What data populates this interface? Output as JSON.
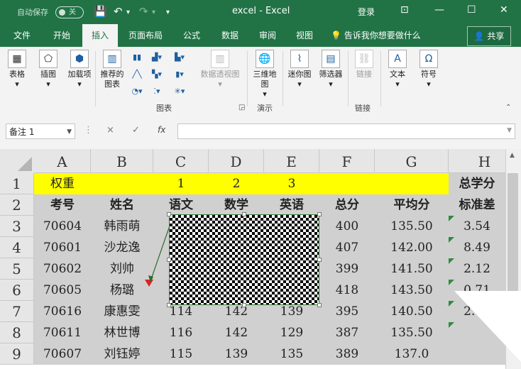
{
  "titlebar": {
    "autosave_label": "自动保存",
    "autosave_state": "关",
    "title": "excel  -  Excel",
    "login": "登录",
    "save_icon": "save-icon",
    "undo_icon": "undo-icon",
    "redo_icon": "redo-icon"
  },
  "tabs": [
    "文件",
    "开始",
    "插入",
    "页面布局",
    "公式",
    "数据",
    "审阅",
    "视图"
  ],
  "active_tab": "插入",
  "tellme": "告诉我你想要做什么",
  "share": "共享",
  "ribbon": {
    "table": "表格",
    "illustrations": "插图",
    "addins": "加载项",
    "recommended_charts": "推荐的图表",
    "pivot_chart": "数据透视图",
    "map3d": "三维地图",
    "sparklines": "迷你图",
    "filters": "筛选器",
    "link": "链接",
    "text": "文本",
    "symbols": "符号",
    "group_charts": "图表",
    "group_tours": "演示",
    "group_links": "链接"
  },
  "formula_bar": {
    "name_box": "备注 1",
    "cancel": "×",
    "enter": "✓",
    "fx": "fx",
    "content": ""
  },
  "columns": [
    "A",
    "B",
    "C",
    "D",
    "E",
    "F",
    "G",
    "H"
  ],
  "rows": [
    "1",
    "2",
    "3",
    "4",
    "5",
    "6",
    "7",
    "8",
    "9"
  ],
  "sheet": {
    "row1": {
      "a": "权重",
      "c": "1",
      "d": "2",
      "e": "3",
      "h": "总学分"
    },
    "headers": {
      "a": "考号",
      "b": "姓名",
      "c": "语文",
      "d": "数学",
      "e": "英语",
      "f": "总分",
      "g": "平均分",
      "h": "标准差"
    },
    "data": [
      {
        "a": "70604",
        "b": "韩雨萌",
        "c": "",
        "d": "",
        "e": "",
        "f": "400",
        "g": "135.50",
        "h": "3.54"
      },
      {
        "a": "70601",
        "b": "沙龙逸",
        "c": "",
        "d": "",
        "e": "",
        "f": "407",
        "g": "142.00",
        "h": "8.49"
      },
      {
        "a": "70602",
        "b": "刘帅",
        "c": "",
        "d": "",
        "e": "",
        "f": "399",
        "g": "141.50",
        "h": "2.12"
      },
      {
        "a": "70605",
        "b": "杨璐",
        "c": "",
        "d": "",
        "e": "",
        "f": "418",
        "g": "143.50",
        "h": "0.71"
      },
      {
        "a": "70616",
        "b": "康惠雯",
        "c": "114",
        "d": "142",
        "e": "139",
        "f": "395",
        "g": "140.50",
        "h": "2.12"
      },
      {
        "a": "70611",
        "b": "林世博",
        "c": "116",
        "d": "142",
        "e": "129",
        "f": "387",
        "g": "135.50",
        "h": ""
      },
      {
        "a": "70607",
        "b": "刘钰婷",
        "c": "115",
        "d": "139",
        "e": "135",
        "f": "389",
        "g": "137.0",
        "h": ""
      }
    ]
  }
}
